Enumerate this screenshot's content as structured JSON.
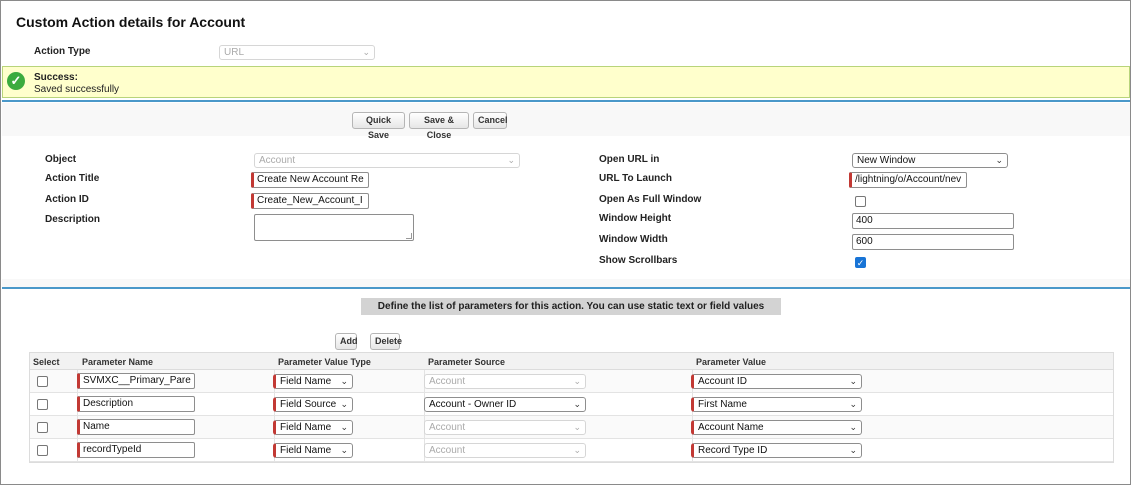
{
  "header": {
    "title": "Custom Action details for Account"
  },
  "action_type": {
    "label": "Action Type",
    "value": "URL"
  },
  "success": {
    "title": "Success:",
    "message": "Saved successfully"
  },
  "buttons": {
    "quick_save": "Quick Save",
    "save_close": "Save & Close",
    "cancel": "Cancel",
    "add": "Add",
    "delete": "Delete"
  },
  "form_left": {
    "object_label": "Object",
    "object_value": "Account",
    "title_label": "Action Title",
    "title_value": "Create New Account Re",
    "id_label": "Action ID",
    "id_value": "Create_New_Account_I",
    "desc_label": "Description",
    "desc_value": ""
  },
  "form_right": {
    "open_label": "Open URL in",
    "open_value": "New Window",
    "url_label": "URL To Launch",
    "url_value": "/lightning/o/Account/nev",
    "full_label": "Open As Full Window",
    "full_checked": false,
    "height_label": "Window Height",
    "height_value": "400",
    "width_label": "Window Width",
    "width_value": "600",
    "scroll_label": "Show Scrollbars",
    "scroll_checked": true
  },
  "params": {
    "banner": "Define the list of parameters for this action. You can use static text or field values",
    "columns": [
      "Select",
      "Parameter Name",
      "Parameter Value Type",
      "Parameter Source",
      "Parameter Value"
    ],
    "rows": [
      {
        "name": "SVMXC__Primary_Pare",
        "value_type": "Field Name",
        "source": "Account",
        "source_enabled": false,
        "value": "Account ID"
      },
      {
        "name": "Description",
        "value_type": "Field Source",
        "source": "Account - Owner ID",
        "source_enabled": true,
        "value": "First Name"
      },
      {
        "name": "Name",
        "value_type": "Field Name",
        "source": "Account",
        "source_enabled": false,
        "value": "Account Name"
      },
      {
        "name": "recordTypeId",
        "value_type": "Field Name",
        "source": "Account",
        "source_enabled": false,
        "value": "Record Type ID"
      }
    ]
  },
  "icons": {
    "success": "check-circle-icon",
    "dropdown": "chevron-down-icon"
  }
}
